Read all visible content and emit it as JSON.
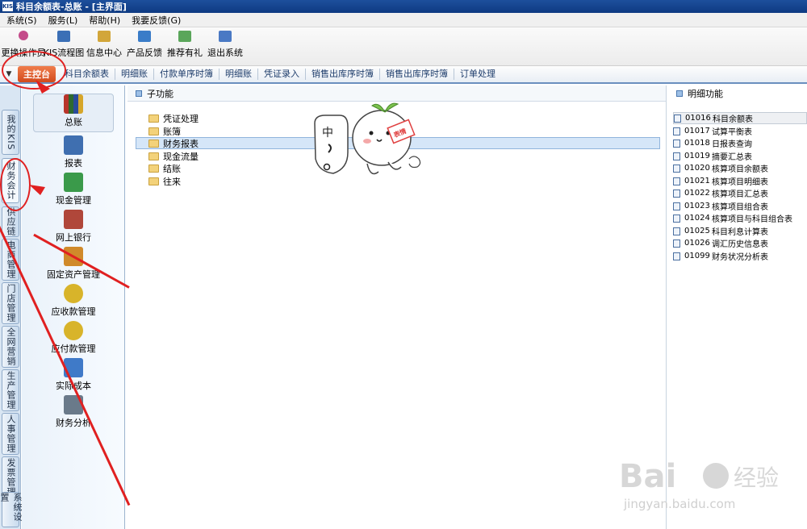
{
  "window": {
    "app_icon_text": "KIS",
    "title": "科目余额表-总账 - [主界面]"
  },
  "menubar": {
    "items": [
      "系统(S)",
      "服务(L)",
      "帮助(H)",
      "我要反馈(G)"
    ]
  },
  "toolbar": {
    "items": [
      {
        "label": "更换操作员",
        "icon": "user-switch-icon",
        "color": "#c44b8a"
      },
      {
        "label": "KIS流程图",
        "icon": "flowchart-icon",
        "color": "#3b6fb6"
      },
      {
        "label": "信息中心",
        "icon": "info-center-icon",
        "color": "#d2a63a"
      },
      {
        "label": "产品反馈",
        "icon": "feedback-icon",
        "color": "#3a7cc8"
      },
      {
        "label": "推荐有礼",
        "icon": "gift-icon",
        "color": "#5aa65a"
      },
      {
        "label": "退出系统",
        "icon": "exit-icon",
        "color": "#4a79c4"
      }
    ]
  },
  "tabbar": {
    "home_label": "主控台",
    "tabs": [
      "科目余额表",
      "明细账",
      "付款单序时簿",
      "明细账",
      "凭证录入",
      "销售出库序时簿",
      "销售出库序时簿",
      "订单处理"
    ]
  },
  "vtabs": [
    "我的KIS",
    "财务会计",
    "供应链",
    "电商管理",
    "门店管理",
    "全网营销",
    "生产管理",
    "人事管理",
    "发票管理",
    "系统设置"
  ],
  "modules": [
    {
      "label": "总账",
      "icon": "ledger-books-icon",
      "color": "#4a7a3a"
    },
    {
      "label": "报表",
      "icon": "report-icon",
      "color": "#3f6fb0"
    },
    {
      "label": "现金管理",
      "icon": "cash-management-icon",
      "color": "#3a9a4a"
    },
    {
      "label": "网上银行",
      "icon": "online-bank-icon",
      "color": "#b0473a"
    },
    {
      "label": "固定资产管理",
      "icon": "fixed-asset-truck-icon",
      "color": "#d08a2a"
    },
    {
      "label": "应收款管理",
      "icon": "receivable-moneybag-icon",
      "color": "#d8b42a"
    },
    {
      "label": "应付款管理",
      "icon": "payable-moneybag-icon",
      "color": "#d8b42a"
    },
    {
      "label": "实际成本",
      "icon": "actual-cost-icon",
      "color": "#3f7ac8"
    },
    {
      "label": "财务分析",
      "icon": "financial-analysis-icon",
      "color": "#6a7a8a"
    }
  ],
  "subfunctions": {
    "header": "子功能",
    "items": [
      "凭证处理",
      "账簿",
      "财务报表",
      "现金流量",
      "结账",
      "往来"
    ],
    "selected_index": 2
  },
  "details": {
    "header": "明细功能",
    "items": [
      {
        "code": "01016",
        "name": "科目余额表"
      },
      {
        "code": "01017",
        "name": "试算平衡表"
      },
      {
        "code": "01018",
        "name": "日报表查询"
      },
      {
        "code": "01019",
        "name": "摘要汇总表"
      },
      {
        "code": "01020",
        "name": "核算项目余额表"
      },
      {
        "code": "01021",
        "name": "核算项目明细表"
      },
      {
        "code": "01022",
        "name": "核算项目汇总表"
      },
      {
        "code": "01023",
        "name": "核算项目组合表"
      },
      {
        "code": "01024",
        "name": "核算项目与科目组合表"
      },
      {
        "code": "01025",
        "name": "科目利息计算表"
      },
      {
        "code": "01026",
        "name": "调汇历史信息表"
      },
      {
        "code": "01099",
        "name": "财务状况分析表"
      }
    ],
    "selected_index": 0
  },
  "mascot": {
    "bubble_text": "中",
    "badge_text": "表情"
  },
  "watermark": {
    "logo": "Bai",
    "logo_cn": "经验",
    "url": "jingyan.baidu.com"
  },
  "colors": {
    "annotation_red": "#e02020",
    "titlebar": "#0e3a82",
    "home_tab": "#e2612f"
  }
}
